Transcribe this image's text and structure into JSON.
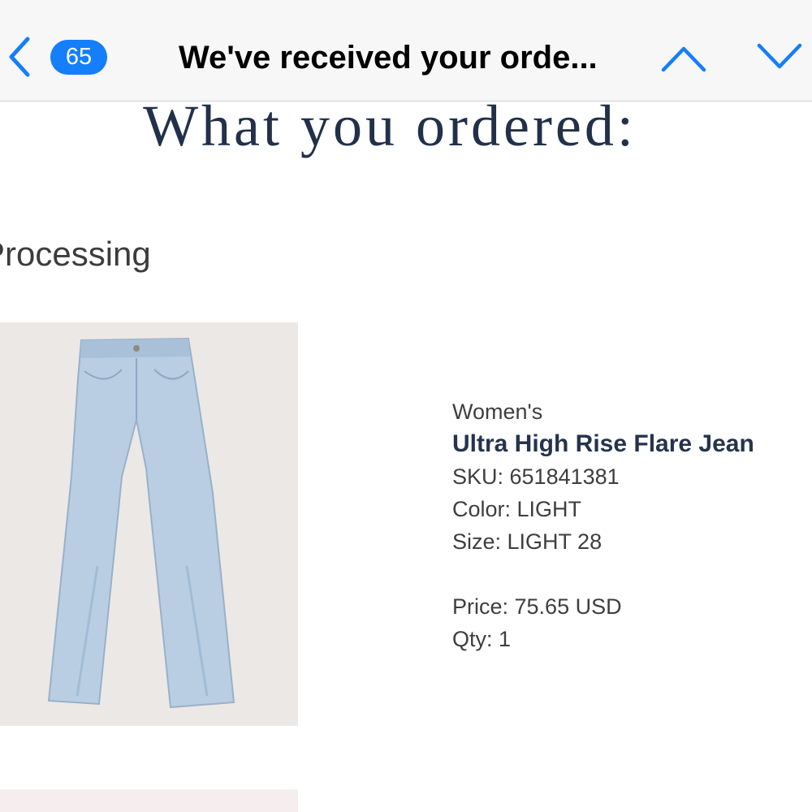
{
  "nav": {
    "badge_count": "65",
    "title": "We've received your orde..."
  },
  "section": {
    "heading": "What you ordered:",
    "status": "Processing"
  },
  "product": {
    "category": "Women's",
    "name": "Ultra High Rise Flare Jean",
    "sku": "SKU: 651841381",
    "color": "Color: LIGHT",
    "size": "Size: LIGHT 28",
    "price": "Price: 75.65 USD",
    "qty": "Qty: 1"
  },
  "colors": {
    "accent": "#147efb",
    "heading": "#22304a",
    "product_name": "#26334d",
    "image_bg": "#ece8e5",
    "denim": "#b9cee3"
  },
  "icons": {
    "back": "chevron-left-icon",
    "prev": "chevron-up-icon",
    "next": "chevron-down-icon"
  }
}
